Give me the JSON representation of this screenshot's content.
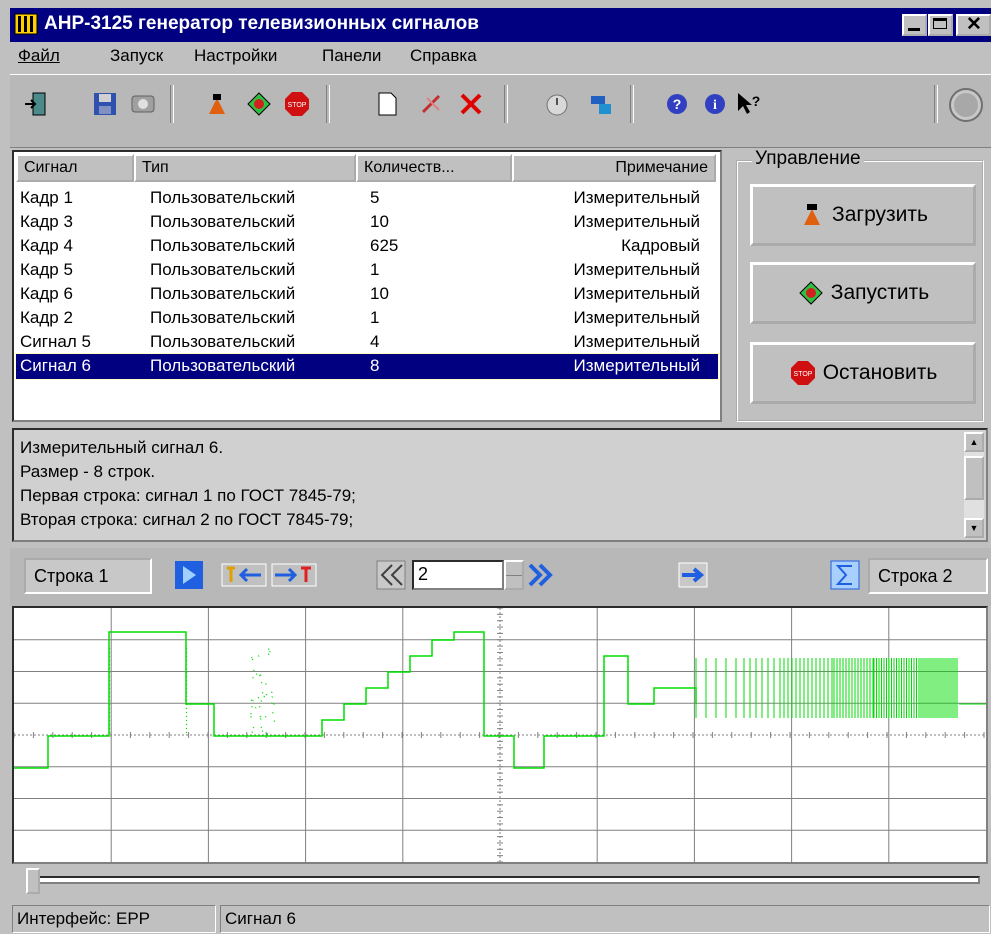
{
  "window": {
    "title": "АНР-3125 генератор телевизионных сигналов"
  },
  "menu": [
    {
      "label": "Файл"
    },
    {
      "label": "Запуск"
    },
    {
      "label": "Настройки"
    },
    {
      "label": "Панели"
    },
    {
      "label": "Справка"
    }
  ],
  "toolbar": {
    "icons": [
      "exit-icon",
      "save-icon",
      "disk-icon",
      "load-icon",
      "run-icon",
      "stop-icon",
      "new-icon",
      "edit-icon",
      "delete-icon",
      "timer-icon",
      "settings-icon",
      "help-icon",
      "info-icon",
      "context-help-icon",
      "indicator-icon"
    ]
  },
  "table": {
    "columns": [
      "Сигнал",
      "Тип",
      "Количеств...",
      "Примечание"
    ],
    "rows": [
      {
        "signal": "Кадр 1",
        "type": "Пользовательский",
        "count": "5",
        "note": "Измерительный"
      },
      {
        "signal": "Кадр 3",
        "type": "Пользовательский",
        "count": "10",
        "note": "Измерительный"
      },
      {
        "signal": "Кадр 4",
        "type": "Пользовательский",
        "count": "625",
        "note": "Кадровый"
      },
      {
        "signal": "Кадр 5",
        "type": "Пользовательский",
        "count": "1",
        "note": "Измерительный"
      },
      {
        "signal": "Кадр 6",
        "type": "Пользовательский",
        "count": "10",
        "note": "Измерительный"
      },
      {
        "signal": "Кадр 2",
        "type": "Пользовательский",
        "count": "1",
        "note": "Измерительный"
      },
      {
        "signal": "Сигнал 5",
        "type": "Пользовательский",
        "count": "4",
        "note": "Измерительный"
      },
      {
        "signal": "Сигнал 6",
        "type": "Пользовательский",
        "count": "8",
        "note": "Измерительный",
        "selected": true
      }
    ]
  },
  "control": {
    "label": "Управление",
    "load": "Загрузить",
    "run": "Запустить",
    "stop": "Остановить"
  },
  "description": {
    "lines": [
      "Измерительный сигнал 6.",
      "Размер - 8 строк.",
      "Первая строка: сигнал 1 по ГОСТ 7845-79;",
      "Вторая строка: сигнал 2 по ГОСТ 7845-79;"
    ]
  },
  "navigation": {
    "line_left": "Строка 1",
    "line_right": "Строка 2",
    "step_value": "2"
  },
  "status": {
    "interface": "Интерфейс: EPP",
    "signal": "Сигнал 6"
  },
  "colors": {
    "titlebar": "#000080",
    "selection": "#000080",
    "waveform": "#00dd00"
  }
}
